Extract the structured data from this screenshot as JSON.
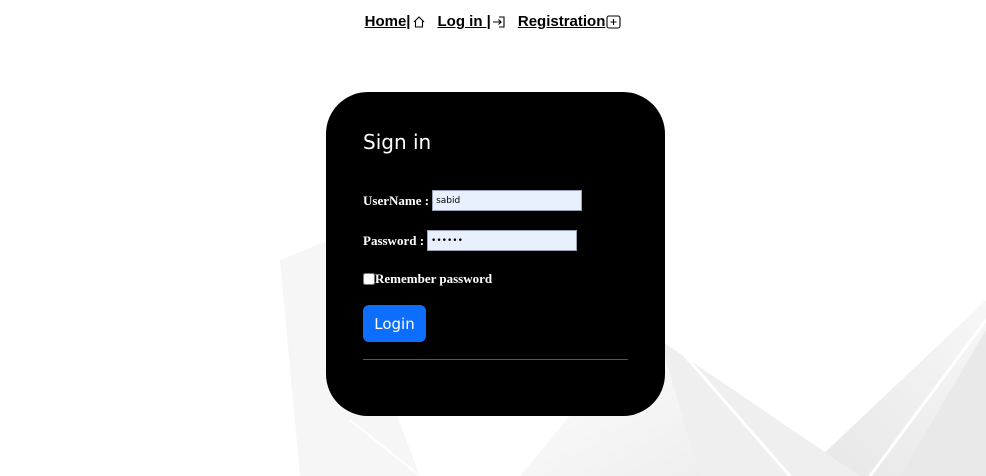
{
  "nav": {
    "home_label": "Home|",
    "home_icon": "home-icon",
    "login_label": "Log in |",
    "login_icon": "sign-in-icon",
    "registration_label": "Registration",
    "registration_icon": "plus-square-icon"
  },
  "signin": {
    "title": "Sign in",
    "username_label": "UserName :",
    "username_value": "sabid",
    "password_label": "Password :",
    "password_value": "••••••",
    "remember_label": "Remember password",
    "remember_checked": false,
    "login_button": "Login"
  },
  "colors": {
    "card_background": "#000000",
    "button_primary": "#0d6efd",
    "input_autofill": "#e8f0fe"
  }
}
